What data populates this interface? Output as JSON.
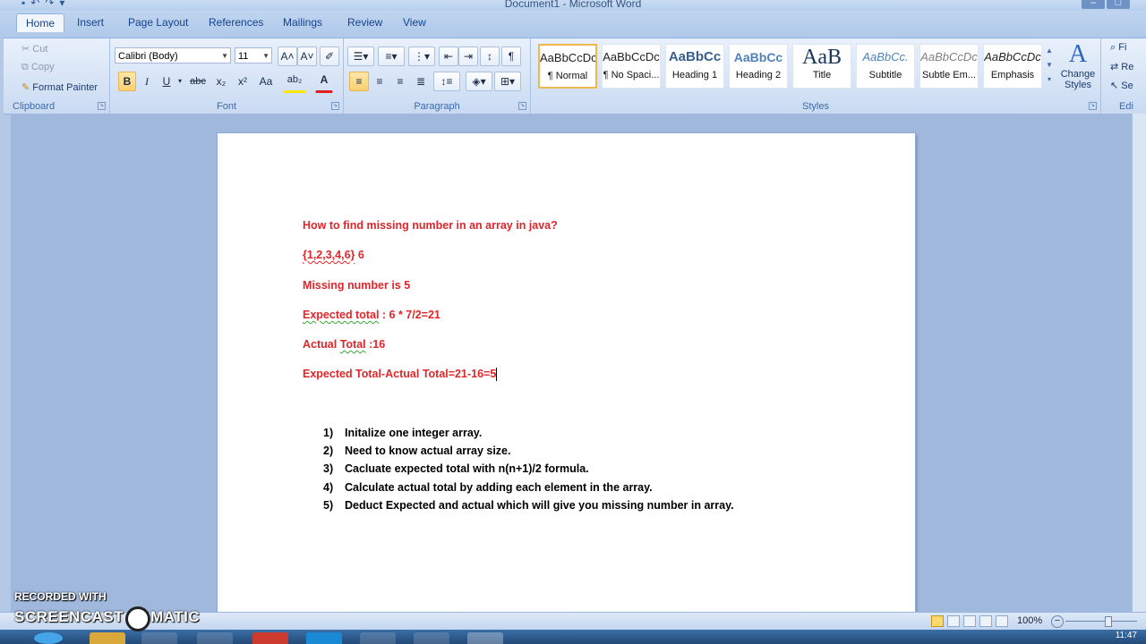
{
  "window": {
    "title": "Document1 - Microsoft Word"
  },
  "tabs": [
    "Home",
    "Insert",
    "Page Layout",
    "References",
    "Mailings",
    "Review",
    "View"
  ],
  "active_tab": "Home",
  "clipboard": {
    "cut": "Cut",
    "copy": "Copy",
    "format_painter": "Format Painter",
    "label": "Clipboard"
  },
  "font": {
    "name": "Calibri (Body)",
    "size": "11",
    "label": "Font",
    "bold": "B",
    "italic": "I",
    "underline": "U",
    "strike": "abc",
    "subscript": "x₂",
    "superscript": "x²",
    "change_case": "Aa",
    "grow": "A˄",
    "shrink": "A˅",
    "highlight": "ab₂",
    "font_color": "A"
  },
  "paragraph": {
    "label": "Paragraph",
    "pilcrow": "¶"
  },
  "styles": {
    "label": "Styles",
    "items": [
      {
        "sample": "AaBbCcDc",
        "name": "¶ Normal"
      },
      {
        "sample": "AaBbCcDc",
        "name": "¶ No Spaci..."
      },
      {
        "sample": "AaBbCс",
        "name": "Heading 1"
      },
      {
        "sample": "AaBbCc",
        "name": "Heading 2"
      },
      {
        "sample": "AaB",
        "name": "Title"
      },
      {
        "sample": "AaBbCc.",
        "name": "Subtitle"
      },
      {
        "sample": "AaBbCcDc",
        "name": "Subtle Em..."
      },
      {
        "sample": "AaBbCcDc",
        "name": "Emphasis"
      }
    ],
    "change_styles": "Change Styles"
  },
  "editing": {
    "label": "Edi",
    "find": "Fi",
    "replace": "Re",
    "select": "Se"
  },
  "document": {
    "heading": "How to find missing number in an array in java?",
    "array_text": "{1,2,3,4,6}",
    "array_n": " 6",
    "missing": "Missing number is 5",
    "expected_label": "Expected total",
    "expected_value": " : 6 * 7/2=21",
    "actual_label_a": "Actual ",
    "actual_label_b": "Total",
    "actual_value": " :16",
    "diff": "Expected Total-Actual Total=21-16=5",
    "steps": [
      {
        "num": "1)",
        "text": "Initalize one integer array."
      },
      {
        "num": "2)",
        "text": "Need to know  actual array size."
      },
      {
        "num": "3)",
        "text": "Cacluate expected total with n(n+1)/2 formula."
      },
      {
        "num": "4)",
        "text": "Calculate actual total by adding each element in the array."
      },
      {
        "num": "5)",
        "text": "Deduct Expected and actual  which will give you missing number in array."
      }
    ]
  },
  "statusbar": {
    "zoom": "100%"
  },
  "watermark": {
    "line1": "RECORDED WITH",
    "line2a": "SCREENCAST",
    "line2b": "MATIC"
  },
  "taskbar": {
    "clock": "11:47"
  }
}
